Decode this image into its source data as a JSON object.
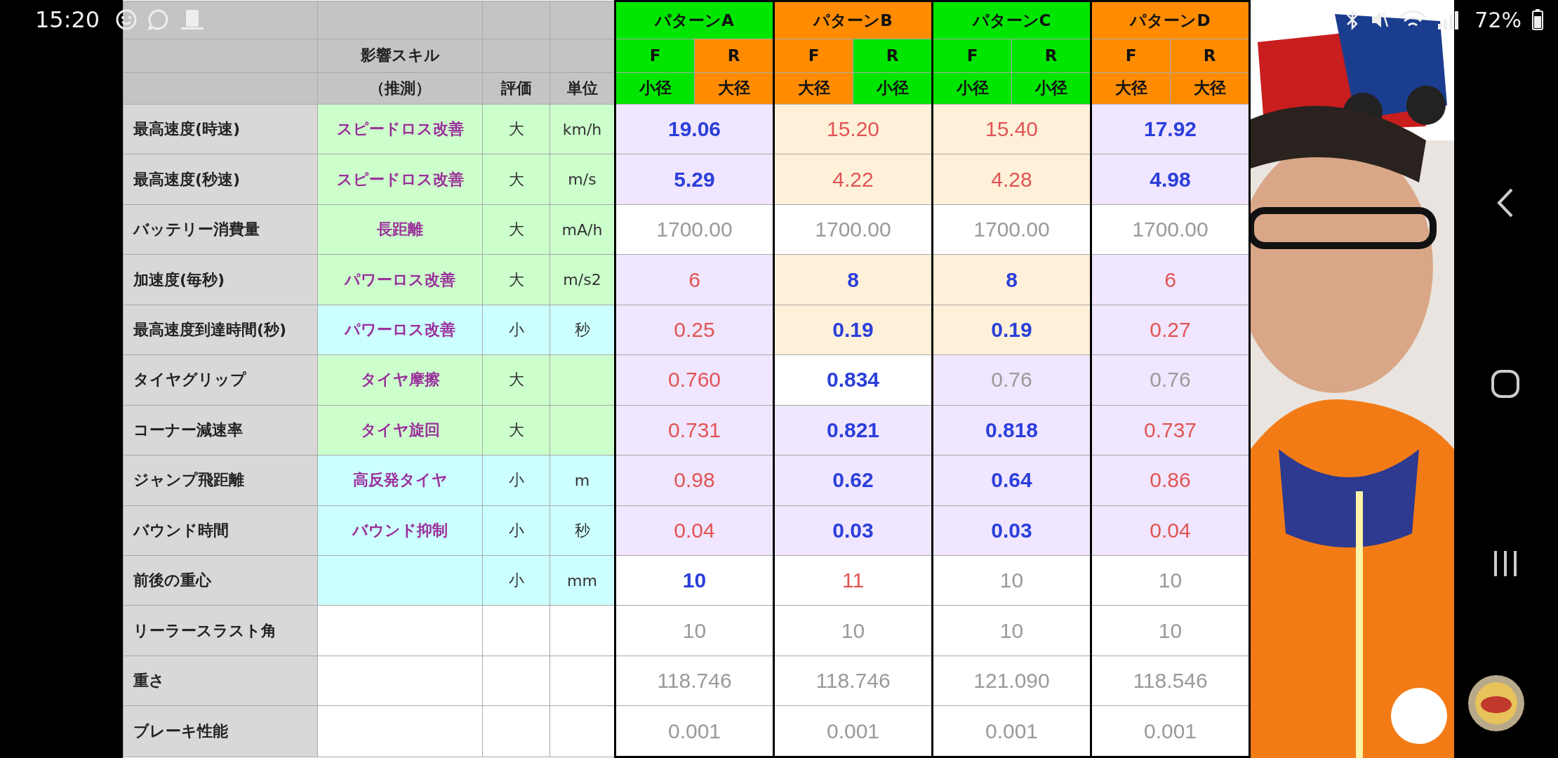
{
  "status_bar": {
    "time": "15:20",
    "battery": "72%"
  },
  "table": {
    "header": {
      "skill_title": "影響スキル",
      "skill_note": "（推測）",
      "rating": "評価",
      "unit": "単位",
      "patterns": [
        {
          "name": "パターンA",
          "color": "#00e600",
          "tires": [
            {
              "position": "F",
              "size": "小径",
              "color": "#00e600"
            },
            {
              "position": "R",
              "size": "大径",
              "color": "#ff8c00"
            }
          ]
        },
        {
          "name": "パターンB",
          "color": "#ff8c00",
          "tires": [
            {
              "position": "F",
              "size": "大径",
              "color": "#ff8c00"
            },
            {
              "position": "R",
              "size": "小径",
              "color": "#00e600"
            }
          ]
        },
        {
          "name": "パターンC",
          "color": "#00e600",
          "tires": [
            {
              "position": "F",
              "size": "小径",
              "color": "#00e600"
            },
            {
              "position": "R",
              "size": "小径",
              "color": "#00e600"
            }
          ]
        },
        {
          "name": "パターンD",
          "color": "#ff8c00",
          "tires": [
            {
              "position": "F",
              "size": "大径",
              "color": "#ff8c00"
            },
            {
              "position": "R",
              "size": "大径",
              "color": "#ff8c00"
            }
          ]
        }
      ]
    },
    "rows": [
      {
        "label": "最高速度(時速)",
        "skill": "スピードロス改善",
        "rating": "大",
        "unit": "km/h",
        "color": "#ccffcc",
        "values": [
          {
            "text": "19.06",
            "kind": "better",
            "color": "#f0e6ff"
          },
          {
            "text": "15.20",
            "kind": "worse",
            "color": "#fff0d9"
          },
          {
            "text": "15.40",
            "kind": "worse",
            "color": "#fff0d9"
          },
          {
            "text": "17.92",
            "kind": "better",
            "color": "#f0e6ff"
          }
        ]
      },
      {
        "label": "最高速度(秒速)",
        "skill": "スピードロス改善",
        "rating": "大",
        "unit": "m/s",
        "color": "#ccffcc",
        "values": [
          {
            "text": "5.29",
            "kind": "better",
            "color": "#f0e6ff"
          },
          {
            "text": "4.22",
            "kind": "worse",
            "color": "#fff0d9"
          },
          {
            "text": "4.28",
            "kind": "worse",
            "color": "#fff0d9"
          },
          {
            "text": "4.98",
            "kind": "better",
            "color": "#f0e6ff"
          }
        ]
      },
      {
        "label": "バッテリー消費量",
        "skill": "長距離",
        "rating": "大",
        "unit": "mA/h",
        "color": "#ccffcc",
        "values": [
          {
            "text": "1700.00",
            "kind": "neutral",
            "color": "#ffffff"
          },
          {
            "text": "1700.00",
            "kind": "neutral",
            "color": "#ffffff"
          },
          {
            "text": "1700.00",
            "kind": "neutral",
            "color": "#ffffff"
          },
          {
            "text": "1700.00",
            "kind": "neutral",
            "color": "#ffffff"
          }
        ]
      },
      {
        "label": "加速度(毎秒)",
        "skill": "パワーロス改善",
        "rating": "大",
        "unit": "m/s2",
        "color": "#ccffcc",
        "values": [
          {
            "text": "6",
            "kind": "worse",
            "color": "#f0e6ff"
          },
          {
            "text": "8",
            "kind": "better",
            "color": "#fff0d9"
          },
          {
            "text": "8",
            "kind": "better",
            "color": "#fff0d9"
          },
          {
            "text": "6",
            "kind": "worse",
            "color": "#f0e6ff"
          }
        ]
      },
      {
        "label": "最高速度到達時間(秒)",
        "skill": "パワーロス改善",
        "rating": "小",
        "unit": "秒",
        "color": "#ccffff",
        "values": [
          {
            "text": "0.25",
            "kind": "worse",
            "color": "#f0e6ff"
          },
          {
            "text": "0.19",
            "kind": "better",
            "color": "#fff0d9"
          },
          {
            "text": "0.19",
            "kind": "better",
            "color": "#fff0d9"
          },
          {
            "text": "0.27",
            "kind": "worse",
            "color": "#f0e6ff"
          }
        ]
      },
      {
        "label": "タイヤグリップ",
        "skill": "タイヤ摩擦",
        "rating": "大",
        "color": "#ccffcc",
        "values": [
          {
            "text": "0.760",
            "kind": "worse",
            "color": "#f0e6ff"
          },
          {
            "text": "0.834",
            "kind": "better",
            "color": "#ffffff"
          },
          {
            "text": "0.76",
            "kind": "neutral",
            "color": "#f0e6ff"
          },
          {
            "text": "0.76",
            "kind": "neutral",
            "color": "#f0e6ff"
          }
        ]
      },
      {
        "label": "コーナー減速率",
        "skill": "タイヤ旋回",
        "rating": "大",
        "color": "#ccffcc",
        "values": [
          {
            "text": "0.731",
            "kind": "worse",
            "color": "#f0e6ff"
          },
          {
            "text": "0.821",
            "kind": "better",
            "color": "#f0e6ff"
          },
          {
            "text": "0.818",
            "kind": "better",
            "color": "#f0e6ff"
          },
          {
            "text": "0.737",
            "kind": "worse",
            "color": "#f0e6ff"
          }
        ]
      },
      {
        "label": "ジャンプ飛距離",
        "skill": "高反発タイヤ",
        "rating": "小",
        "unit": "m",
        "color": "#ccffff",
        "values": [
          {
            "text": "0.98",
            "kind": "worse",
            "color": "#f0e6ff"
          },
          {
            "text": "0.62",
            "kind": "better",
            "color": "#f0e6ff"
          },
          {
            "text": "0.64",
            "kind": "better",
            "color": "#f0e6ff"
          },
          {
            "text": "0.86",
            "kind": "worse",
            "color": "#f0e6ff"
          }
        ]
      },
      {
        "label": "バウンド時間",
        "skill": "バウンド抑制",
        "rating": "小",
        "unit": "秒",
        "color": "#ccffff",
        "values": [
          {
            "text": "0.04",
            "kind": "worse",
            "color": "#f0e6ff"
          },
          {
            "text": "0.03",
            "kind": "better",
            "color": "#f0e6ff"
          },
          {
            "text": "0.03",
            "kind": "better",
            "color": "#f0e6ff"
          },
          {
            "text": "0.04",
            "kind": "worse",
            "color": "#f0e6ff"
          }
        ]
      },
      {
        "label": "前後の重心",
        "rating": "小",
        "unit": "mm",
        "color": "#ccffff",
        "values": [
          {
            "text": "10",
            "kind": "better",
            "color": "#ffffff"
          },
          {
            "text": "11",
            "kind": "worse",
            "color": "#ffffff"
          },
          {
            "text": "10",
            "kind": "neutral",
            "color": "#ffffff"
          },
          {
            "text": "10",
            "kind": "neutral",
            "color": "#ffffff"
          }
        ]
      },
      {
        "label": "リーラースラスト角",
        "color": "#ffffff",
        "values": [
          {
            "text": "10",
            "kind": "neutral",
            "color": "#ffffff"
          },
          {
            "text": "10",
            "kind": "neutral",
            "color": "#ffffff"
          },
          {
            "text": "10",
            "kind": "neutral",
            "color": "#ffffff"
          },
          {
            "text": "10",
            "kind": "neutral",
            "color": "#ffffff"
          }
        ]
      },
      {
        "label": "重さ",
        "color": "#ffffff",
        "values": [
          {
            "text": "118.746",
            "kind": "neutral",
            "color": "#ffffff"
          },
          {
            "text": "118.746",
            "kind": "neutral",
            "color": "#ffffff"
          },
          {
            "text": "121.090",
            "kind": "neutral",
            "color": "#ffffff"
          },
          {
            "text": "118.546",
            "kind": "neutral",
            "color": "#ffffff"
          }
        ]
      },
      {
        "label": "ブレーキ性能",
        "color": "#ffffff",
        "values": [
          {
            "text": "0.001",
            "kind": "neutral",
            "color": "#ffffff"
          },
          {
            "text": "0.001",
            "kind": "neutral",
            "color": "#ffffff"
          },
          {
            "text": "0.001",
            "kind": "neutral",
            "color": "#ffffff"
          },
          {
            "text": "0.001",
            "kind": "neutral",
            "color": "#ffffff"
          }
        ]
      }
    ]
  }
}
